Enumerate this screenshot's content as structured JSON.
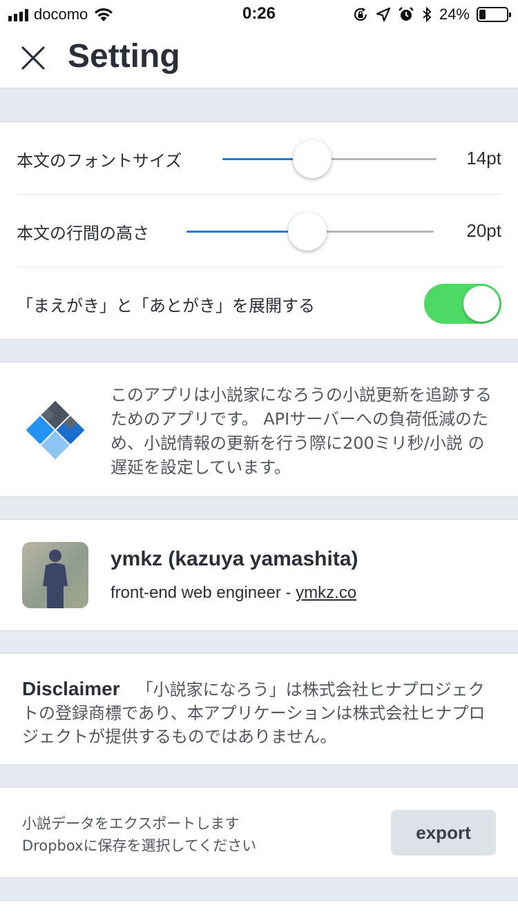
{
  "status_bar": {
    "carrier": "docomo",
    "time": "0:26",
    "battery_percent": "24%",
    "battery_level": 0.24,
    "icons": [
      "signal-icon",
      "wifi-icon",
      "orientation-lock-icon",
      "location-icon",
      "alarm-icon",
      "bluetooth-icon",
      "battery-icon"
    ]
  },
  "header": {
    "title": "Setting",
    "close_icon": "close-icon"
  },
  "settings": {
    "font_size": {
      "label": "本文のフォントサイズ",
      "value": "14pt",
      "level": 0.42
    },
    "line_height": {
      "label": "本文の行間の高さ",
      "value": "20pt",
      "level": 0.49
    },
    "expand": {
      "label": "「まえがき」と「あとがき」を展開する",
      "enabled": true
    }
  },
  "about": {
    "logo_icon": "app-logo-icon",
    "text": "このアプリは小説家になろうの小説更新を追跡するためのアプリです。 APIサーバーへの負荷低減のため、小説情報の更新を行う際に200ミリ秒/小説 の遅延を設定しています。"
  },
  "author": {
    "name": "ymkz (kazuya yamashita)",
    "role": "front-end web engineer - ",
    "link": "ymkz.co"
  },
  "disclaimer": {
    "title": "Disclaimer",
    "text": "「小説家になろう」は株式会社ヒナプロジェクトの登録商標であり、本アプリケーションは株式会社ヒナプロジェクトが提供するものではありません。"
  },
  "export": {
    "line1": "小説データをエクスポートします",
    "line2": "Dropboxに保存を選択してください",
    "button_label": "export"
  },
  "colors": {
    "accent": "#1f7bd8",
    "toggle_on": "#4cd964",
    "background": "#e6eaf1"
  }
}
